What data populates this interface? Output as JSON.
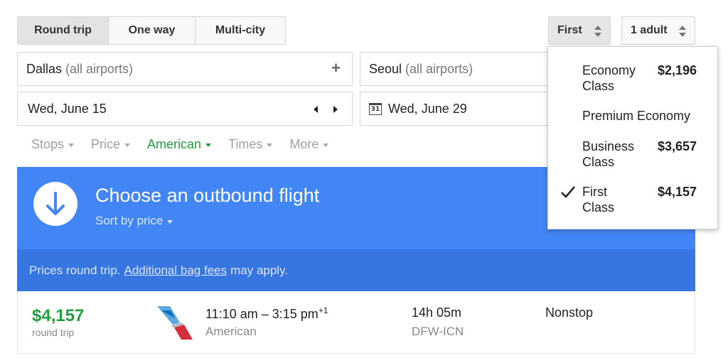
{
  "trip_type": {
    "options": [
      "Round trip",
      "One way",
      "Multi-city"
    ],
    "selected": "Round trip"
  },
  "cabin_select": {
    "value": "First"
  },
  "passengers_select": {
    "value": "1 adult"
  },
  "origin": {
    "city": "Dallas",
    "qualifier": "(all airports)"
  },
  "destination": {
    "city": "Seoul",
    "qualifier": "(all airports)"
  },
  "depart_date": "Wed, June 15",
  "return_date": {
    "icon_text": "31",
    "value": "Wed, June 29"
  },
  "filters": [
    {
      "label": "Stops",
      "active": false
    },
    {
      "label": "Price",
      "active": false
    },
    {
      "label": "American",
      "active": true
    },
    {
      "label": "Times",
      "active": false
    },
    {
      "label": "More",
      "active": false
    }
  ],
  "banner": {
    "title": "Choose an outbound flight",
    "sort_label": "Sort by price"
  },
  "notice": {
    "before": "Prices round trip.",
    "link": "Additional bag fees",
    "after": "may apply."
  },
  "result": {
    "price": "$4,157",
    "price_note": "round trip",
    "depart_time": "11:10 am",
    "separator": "–",
    "arrive_time": "3:15 pm",
    "day_offset": "+1",
    "airline": "American",
    "duration": "14h 05m",
    "route": "DFW-ICN",
    "stops": "Nonstop"
  },
  "cabin_dropdown": {
    "items": [
      {
        "line1": "Economy",
        "line2": "Class",
        "price": "$2,196",
        "checked": false
      },
      {
        "line1": "Premium Economy",
        "line2": "",
        "price": "",
        "checked": false
      },
      {
        "line1": "Business",
        "line2": "Class",
        "price": "$3,657",
        "checked": false
      },
      {
        "line1": "First",
        "line2": "Class",
        "price": "$4,157",
        "checked": true
      }
    ]
  },
  "colors": {
    "banner_blue": "#4285f4",
    "notice_blue": "#3775e0",
    "price_green": "#249c3f",
    "active_filter_green": "#249c3f"
  },
  "icons": [
    "plus-icon",
    "arrow-left-icon",
    "arrow-right-icon",
    "calendar-icon",
    "down-arrow-circle-icon",
    "american-airlines-logo",
    "checkmark-icon"
  ]
}
